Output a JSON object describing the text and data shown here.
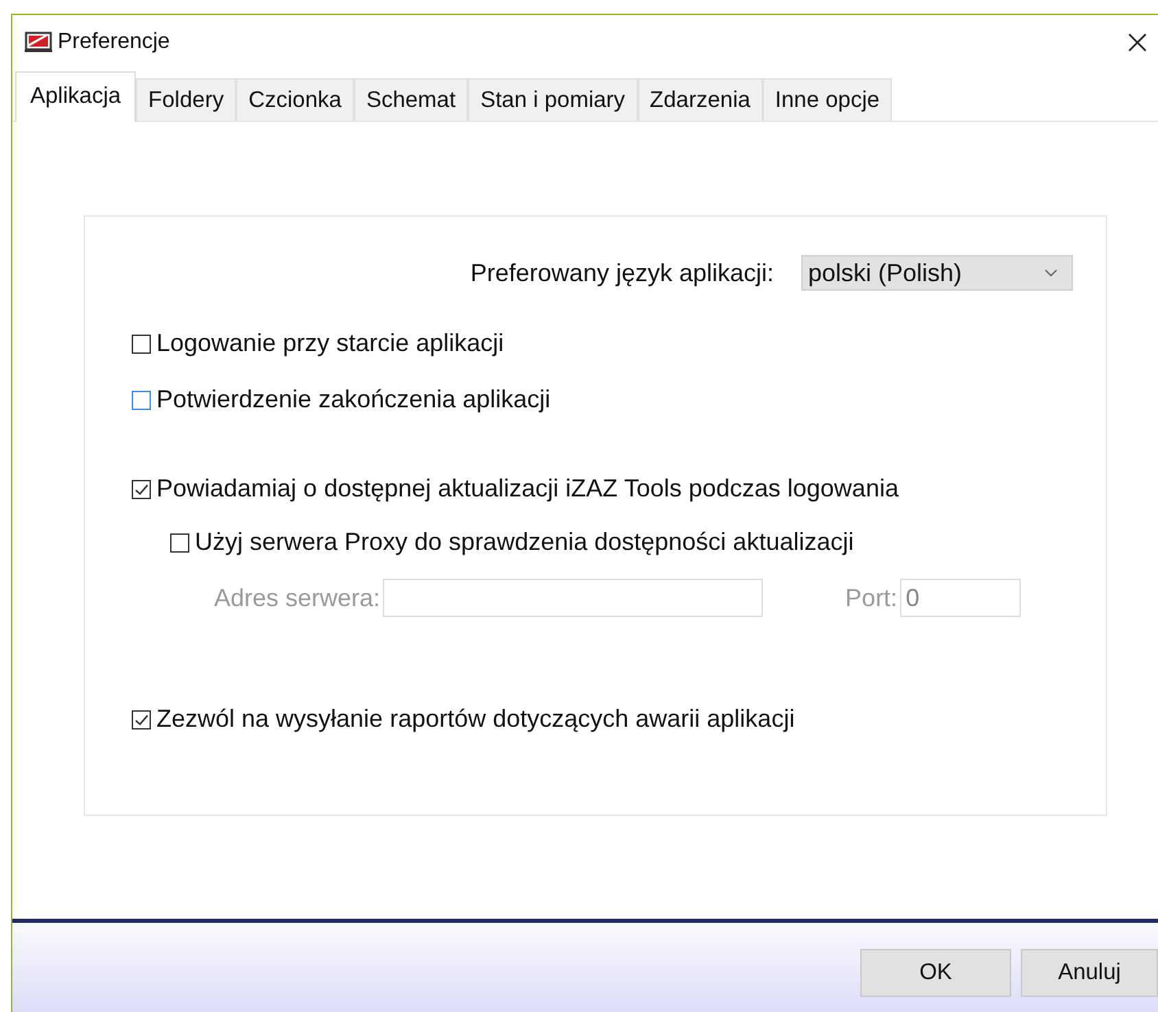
{
  "window": {
    "title": "Preferencje"
  },
  "tabs": [
    {
      "label": "Aplikacja",
      "selected": true
    },
    {
      "label": "Foldery",
      "selected": false
    },
    {
      "label": "Czcionka",
      "selected": false
    },
    {
      "label": "Schemat",
      "selected": false
    },
    {
      "label": "Stan i pomiary",
      "selected": false
    },
    {
      "label": "Zdarzenia",
      "selected": false
    },
    {
      "label": "Inne opcje",
      "selected": false
    }
  ],
  "language": {
    "label": "Preferowany język aplikacji:",
    "value": "polski (Polish)"
  },
  "option_groups": [
    {
      "items": [
        {
          "label": "Logowanie przy starcie aplikacji",
          "checked": false,
          "color": "#333333"
        },
        {
          "label": "Potwierdzenie zakończenia aplikacji",
          "checked": false,
          "color": "#3c8ede"
        }
      ]
    },
    {
      "items": [
        {
          "label": "Powiadamiaj o dostępnej aktualizacji iZAZ Tools podczas logowania",
          "checked": true,
          "color": "#333333",
          "children": [
            {
              "label": "Użyj serwera Proxy do sprawdzenia dostępności aktualizacji",
              "checked": false,
              "color": "#333333"
            }
          ]
        }
      ]
    },
    {
      "items": [
        {
          "label": "Zezwól na wysyłanie raportów dotyczących awarii aplikacji",
          "checked": true,
          "color": "#333333"
        }
      ]
    }
  ],
  "proxy": {
    "disabled": true,
    "server_label": "Adres serwera:",
    "port_label": "Port:",
    "port_value": "0"
  },
  "buttons": [
    {
      "label": "OK"
    },
    {
      "label": "Anuluj"
    }
  ]
}
